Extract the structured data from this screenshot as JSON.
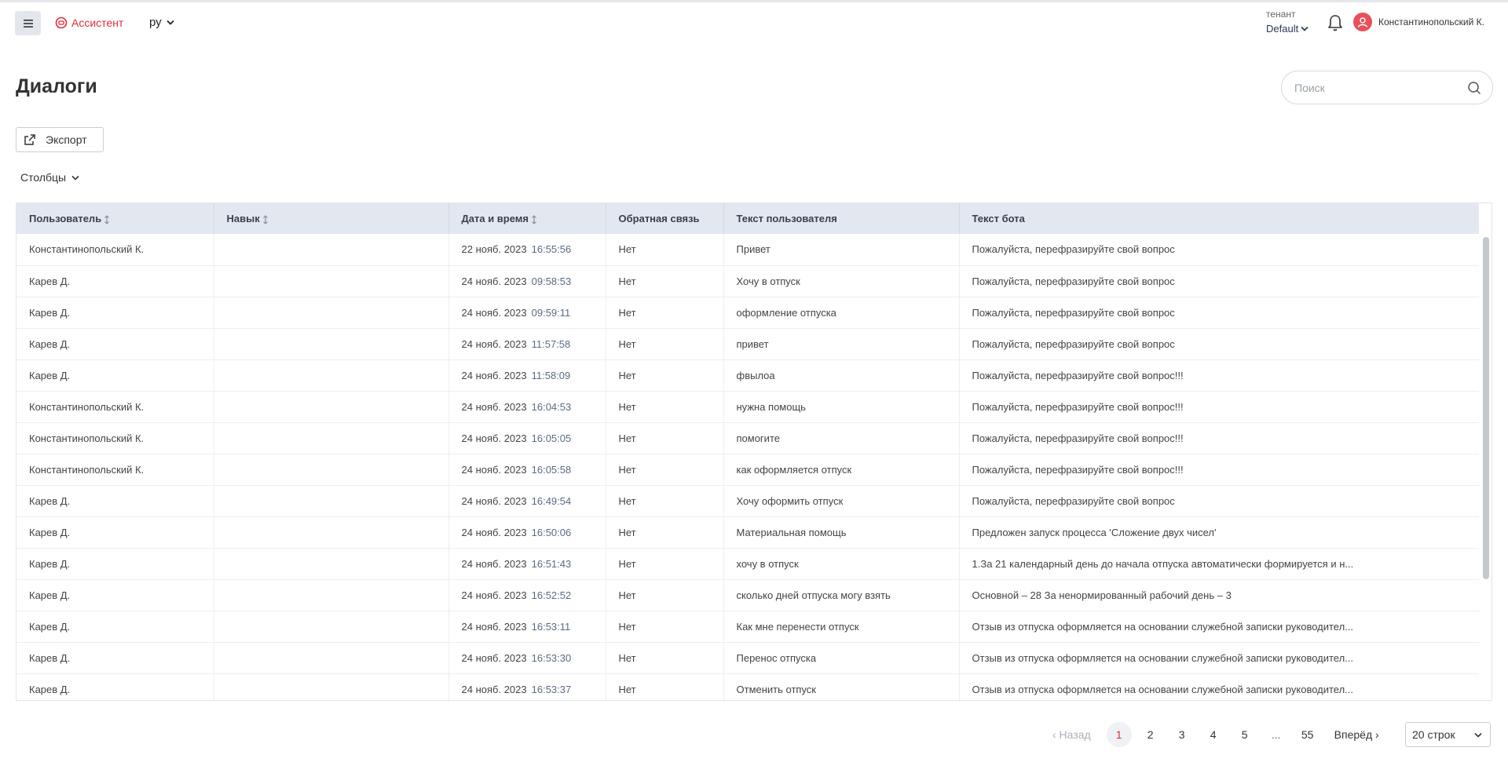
{
  "header": {
    "app_name": "Ассистент",
    "language": "ру",
    "tenant_label": "тенант",
    "tenant_value": "Default",
    "user_name": "Константинопольский К."
  },
  "page": {
    "title": "Диалоги",
    "search_placeholder": "Поиск",
    "export_label": "Экспорт",
    "columns_label": "Столбцы"
  },
  "table": {
    "headers": {
      "user": "Пользователь",
      "skill": "Навык",
      "datetime": "Дата и время",
      "feedback": "Обратная связь",
      "user_text": "Текст пользователя",
      "bot_text": "Текст бота"
    },
    "rows": [
      {
        "user": "Константинопольский К.",
        "skill": "",
        "date": "22 нояб. 2023",
        "time": "16:55:56",
        "feedback": "Нет",
        "user_text": "Привет",
        "bot_text": "Пожалуйста, перефразируйте свой вопрос"
      },
      {
        "user": "Карев Д.",
        "skill": "",
        "date": "24 нояб. 2023",
        "time": "09:58:53",
        "feedback": "Нет",
        "user_text": "Хочу в отпуск",
        "bot_text": "Пожалуйста, перефразируйте свой вопрос"
      },
      {
        "user": "Карев Д.",
        "skill": "",
        "date": "24 нояб. 2023",
        "time": "09:59:11",
        "feedback": "Нет",
        "user_text": "оформление отпуска",
        "bot_text": "Пожалуйста, перефразируйте свой вопрос"
      },
      {
        "user": "Карев Д.",
        "skill": "",
        "date": "24 нояб. 2023",
        "time": "11:57:58",
        "feedback": "Нет",
        "user_text": "привет",
        "bot_text": "Пожалуйста, перефразируйте свой вопрос"
      },
      {
        "user": "Карев Д.",
        "skill": "",
        "date": "24 нояб. 2023",
        "time": "11:58:09",
        "feedback": "Нет",
        "user_text": "фвылоа",
        "bot_text": "Пожалуйста, перефразируйте свой вопрос!!!"
      },
      {
        "user": "Константинопольский К.",
        "skill": "",
        "date": "24 нояб. 2023",
        "time": "16:04:53",
        "feedback": "Нет",
        "user_text": "нужна помощь",
        "bot_text": "Пожалуйста, перефразируйте свой вопрос!!!"
      },
      {
        "user": "Константинопольский К.",
        "skill": "",
        "date": "24 нояб. 2023",
        "time": "16:05:05",
        "feedback": "Нет",
        "user_text": "помогите",
        "bot_text": "Пожалуйста, перефразируйте свой вопрос!!!"
      },
      {
        "user": "Константинопольский К.",
        "skill": "",
        "date": "24 нояб. 2023",
        "time": "16:05:58",
        "feedback": "Нет",
        "user_text": "как оформляется отпуск",
        "bot_text": "Пожалуйста, перефразируйте свой вопрос!!!"
      },
      {
        "user": "Карев Д.",
        "skill": "",
        "date": "24 нояб. 2023",
        "time": "16:49:54",
        "feedback": "Нет",
        "user_text": "Хочу оформить отпуск",
        "bot_text": "Пожалуйста, перефразируйте свой вопрос"
      },
      {
        "user": "Карев Д.",
        "skill": "",
        "date": "24 нояб. 2023",
        "time": "16:50:06",
        "feedback": "Нет",
        "user_text": "Материальная помощь",
        "bot_text": "Предложен запуск процесса 'Сложение двух чисел'"
      },
      {
        "user": "Карев Д.",
        "skill": "",
        "date": "24 нояб. 2023",
        "time": "16:51:43",
        "feedback": "Нет",
        "user_text": "хочу в отпуск",
        "bot_text": "1.За 21 календарный день до начала отпуска автоматически формируется и н..."
      },
      {
        "user": "Карев Д.",
        "skill": "",
        "date": "24 нояб. 2023",
        "time": "16:52:52",
        "feedback": "Нет",
        "user_text": "сколько дней отпуска могу взять",
        "bot_text": "Основной – 28 За ненормированный рабочий день – 3"
      },
      {
        "user": "Карев Д.",
        "skill": "",
        "date": "24 нояб. 2023",
        "time": "16:53:11",
        "feedback": "Нет",
        "user_text": "Как мне перенести отпуск",
        "bot_text": "Отзыв из отпуска оформляется на основании служебной записки руководител..."
      },
      {
        "user": "Карев Д.",
        "skill": "",
        "date": "24 нояб. 2023",
        "time": "16:53:30",
        "feedback": "Нет",
        "user_text": "Перенос отпуска",
        "bot_text": "Отзыв из отпуска оформляется на основании служебной записки руководител..."
      },
      {
        "user": "Карев Д.",
        "skill": "",
        "date": "24 нояб. 2023",
        "time": "16:53:37",
        "feedback": "Нет",
        "user_text": "Отменить отпуск",
        "bot_text": "Отзыв из отпуска оформляется на основании служебной записки руководител..."
      }
    ]
  },
  "pagination": {
    "prev_label": "‹ Назад",
    "pages": [
      "1",
      "2",
      "3",
      "4",
      "5",
      "...",
      "55"
    ],
    "active_page": "1",
    "next_label": "Вперёд ›",
    "rows_per_page": "20 строк"
  },
  "colors": {
    "accent": "#e02b3c",
    "header_bg": "#e3e7f0",
    "time_color": "#5a6b85"
  }
}
